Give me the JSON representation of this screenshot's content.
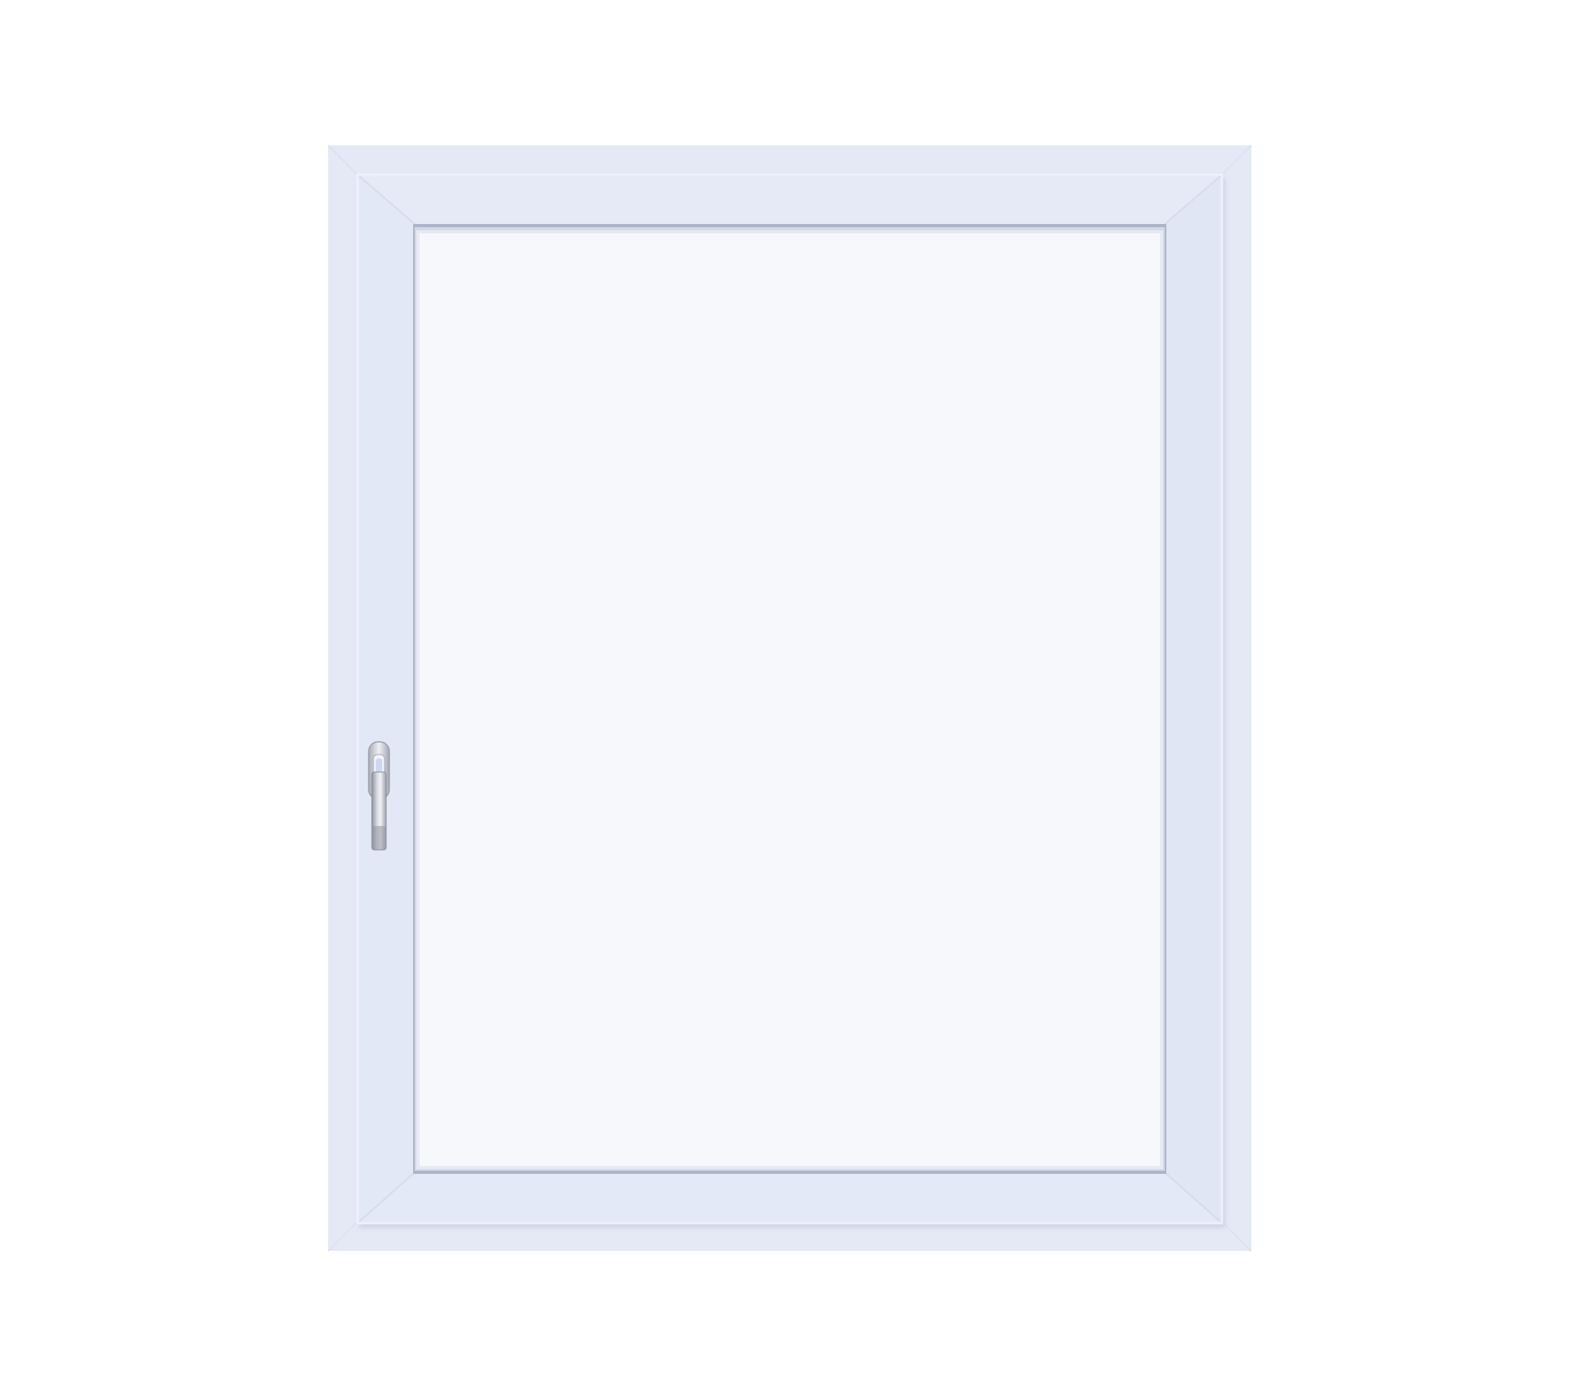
{
  "scene": {
    "subject": "window-with-handle",
    "colors": {
      "background": "#ffffff",
      "frame_outer": "#e5e9f6",
      "frame_outer_edge": "#edf0fa",
      "sash": "#e2e7f5",
      "sash_highlight": "#eef1fb",
      "sash_shadow": "#c9cfdf",
      "glass": "#f7f8fb",
      "glass_bead": "#aeb5c8",
      "handle_metal": "#b9bcc6",
      "handle_dark": "#8e929e",
      "handle_highlight": "#f1f2f6"
    },
    "icons": [
      "window-frame-icon",
      "window-handle-icon"
    ]
  }
}
